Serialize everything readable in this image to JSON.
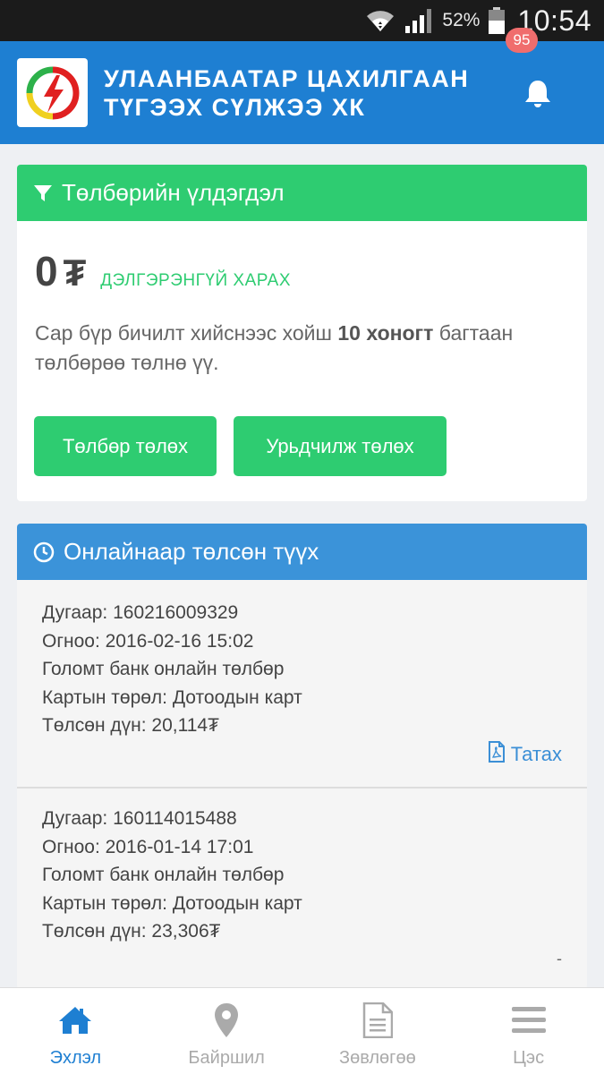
{
  "status_bar": {
    "battery_percent": "52%",
    "time": "10:54"
  },
  "header": {
    "title_line1": "Улаанбаатар цахилгаан",
    "title_line2": "түгээх сүлжээ ХК",
    "notification_count": "95",
    "brand_color": "#1e7fd2"
  },
  "balance": {
    "title": "Төлбөрийн үлдэгдэл",
    "amount": "0",
    "currency": "₮",
    "details_link": "ДЭЛГЭРЭНГҮЙ ХАРАХ",
    "notice_pre": "Сар бүр бичилт хийснээс хойш ",
    "notice_bold": "10 хоногт",
    "notice_post": " багтаан төлбөрөө төлнө үү.",
    "pay_button": "Төлбөр төлөх",
    "prepay_button": "Урьдчилж төлөх",
    "accent_color": "#2ecc71"
  },
  "history": {
    "title": "Онлайнаар төлсөн түүх",
    "download_label": "Татах",
    "items": [
      {
        "number": "Дугаар: 160216009329",
        "date": "Огноо: 2016-02-16 15:02",
        "bank": "Голомт банк онлайн төлбөр",
        "card_type": "Картын төрөл: Дотоодын карт",
        "amount": "Төлсөн дүн: 20,114₮"
      },
      {
        "number": "Дугаар: 160114015488",
        "date": "Огноо: 2016-01-14 17:01",
        "bank": "Голомт банк онлайн төлбөр",
        "card_type": "Картын төрөл: Дотоодын карт",
        "amount": "Төлсөн дүн: 23,306₮"
      }
    ],
    "second_marker": "-"
  },
  "nav": {
    "items": [
      {
        "label": "Эхлэл",
        "icon": "home-icon",
        "active": true
      },
      {
        "label": "Байршил",
        "icon": "map-pin-icon",
        "active": false
      },
      {
        "label": "Зөвлөгөө",
        "icon": "document-icon",
        "active": false
      },
      {
        "label": "Цэс",
        "icon": "menu-icon",
        "active": false
      }
    ]
  }
}
